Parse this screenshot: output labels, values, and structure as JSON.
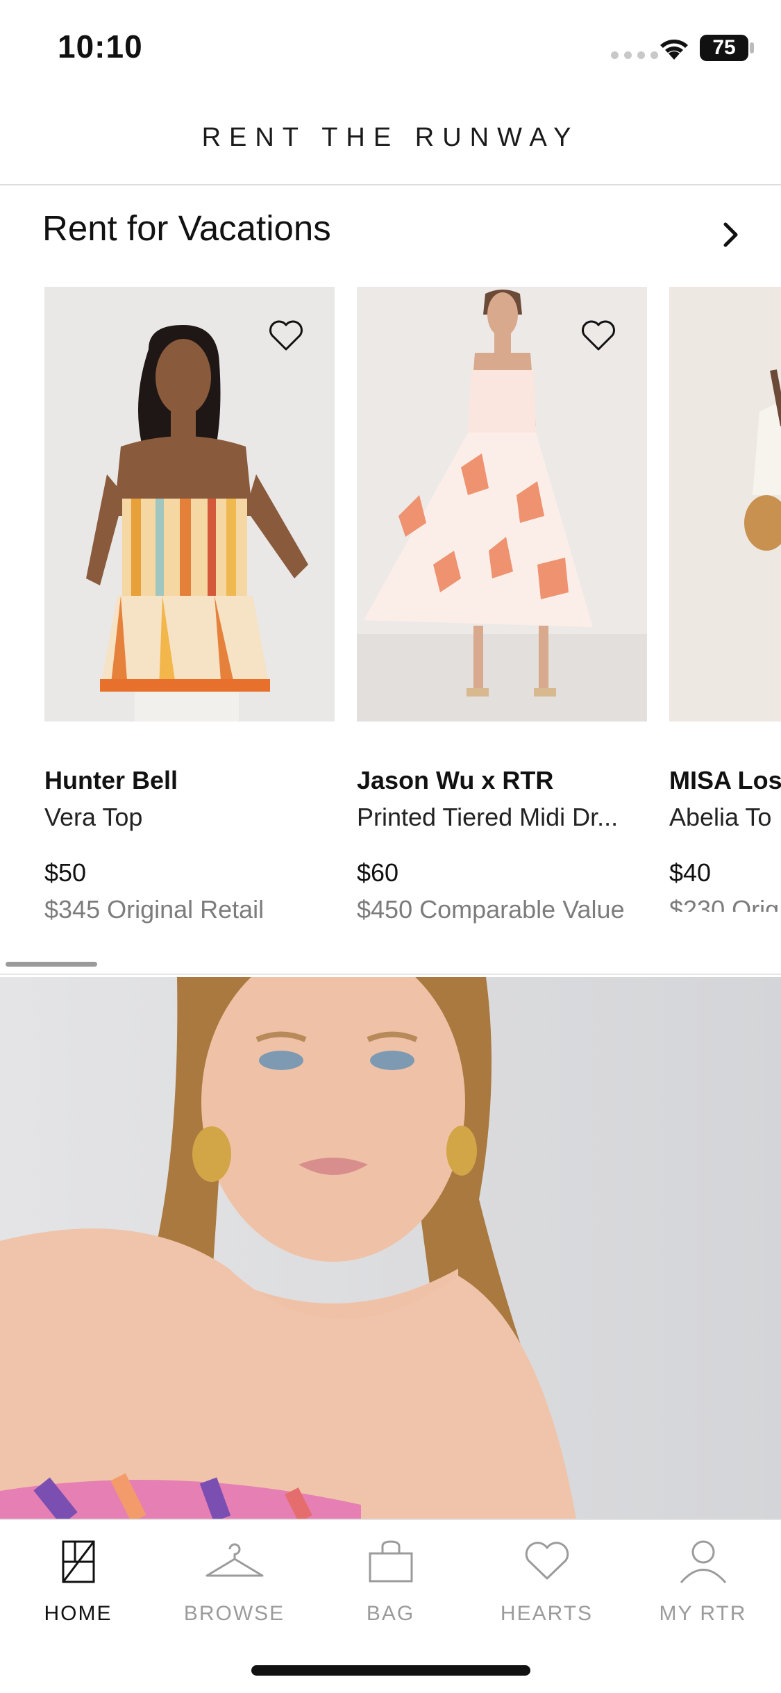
{
  "status_bar": {
    "time": "10:10",
    "battery": "75"
  },
  "header": {
    "brand": "RENT THE RUNWAY"
  },
  "section": {
    "title": "Rent for Vacations"
  },
  "products": [
    {
      "brand": "Hunter Bell",
      "name": "Vera Top",
      "price": "$50",
      "retail": "$345 Original Retail"
    },
    {
      "brand": "Jason Wu x RTR",
      "name": "Printed Tiered Midi Dr...",
      "price": "$60",
      "retail": "$450 Comparable Value"
    },
    {
      "brand": "MISA Los",
      "name": "Abelia To",
      "price": "$40",
      "retail": "$230 Orig"
    }
  ],
  "tabs": [
    {
      "label": "HOME",
      "icon": "home-icon",
      "active": true
    },
    {
      "label": "BROWSE",
      "icon": "hanger-icon",
      "active": false
    },
    {
      "label": "BAG",
      "icon": "bag-icon",
      "active": false
    },
    {
      "label": "HEARTS",
      "icon": "heart-icon",
      "active": false
    },
    {
      "label": "MY RTR",
      "icon": "person-icon",
      "active": false
    }
  ],
  "colors": {
    "active_tab": "#111111",
    "inactive_tab": "#9b9b9b",
    "muted_text": "#7c7c7c"
  }
}
